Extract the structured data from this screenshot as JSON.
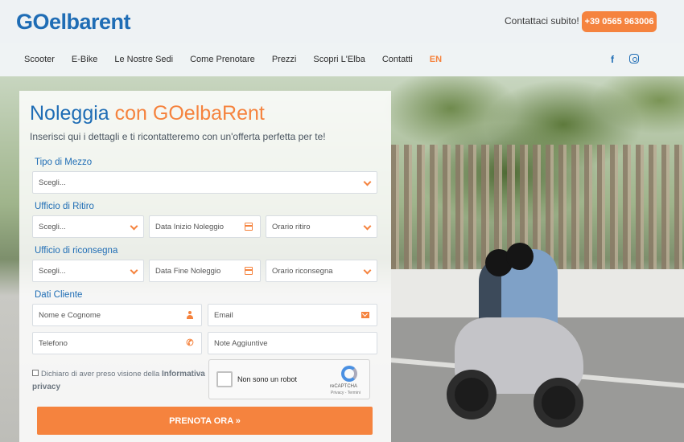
{
  "header": {
    "logo_text": "GOelbarent",
    "contact_label": "Contattaci subito!",
    "phone": "+39 0565 963006"
  },
  "nav": {
    "items": [
      "Scooter",
      "E-Bike",
      "Le Nostre Sedi",
      "Come Prenotare",
      "Prezzi",
      "Scopri L'Elba",
      "Contatti"
    ],
    "language": "EN",
    "social_icons": [
      "facebook-icon",
      "instagram-icon"
    ]
  },
  "form": {
    "title_main": "Noleggia",
    "title_accent": "con GOelbaRent",
    "subtitle": "Inserisci qui i dettagli e ti ricontatteremo con un'offerta perfetta per te!",
    "vehicle": {
      "label": "Tipo di Mezzo",
      "value": "Scegli..."
    },
    "pickup": {
      "label": "Ufficio di Ritiro",
      "office": "Scegli...",
      "date_placeholder": "Data Inizio Noleggio",
      "time": "Orario ritiro"
    },
    "return": {
      "label": "Ufficio di riconsegna",
      "office": "Scegli...",
      "date_placeholder": "Data Fine Noleggio",
      "time": "Orario riconsegna"
    },
    "customer": {
      "label": "Dati Cliente",
      "name_placeholder": "Nome e Cognome",
      "email_placeholder": "Email",
      "phone_placeholder": "Telefono",
      "notes_placeholder": "Note Aggiuntive"
    },
    "privacy": {
      "text": "Dichiaro di aver preso visione della",
      "link": "Informativa privacy"
    },
    "recaptcha": {
      "label": "Non sono un robot",
      "brand": "reCAPTCHA",
      "terms": "Privacy - Termini"
    },
    "submit_label": "PRENOTA ORA »"
  },
  "colors": {
    "brand_blue": "#1f6db5",
    "brand_orange": "#f5833e"
  }
}
